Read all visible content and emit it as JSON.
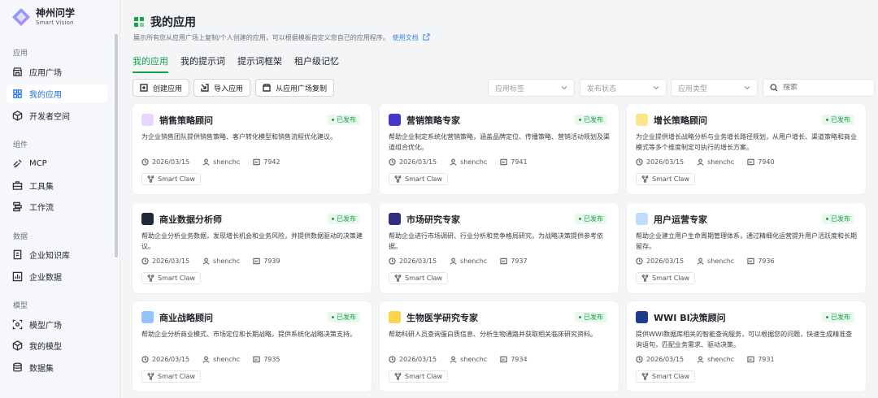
{
  "brand": {
    "name": "神州问学",
    "subtitle": "Smart Vision"
  },
  "sidebar": {
    "sections": [
      {
        "title": "应用",
        "items": [
          {
            "label": "应用广场",
            "icon": "store-icon"
          },
          {
            "label": "我的应用",
            "icon": "grid-icon",
            "active": true
          },
          {
            "label": "开发者空间",
            "icon": "cube-icon"
          }
        ]
      },
      {
        "title": "组件",
        "items": [
          {
            "label": "MCP",
            "icon": "mcp-icon"
          },
          {
            "label": "工具集",
            "icon": "toolbox-icon"
          },
          {
            "label": "工作流",
            "icon": "workflow-icon"
          }
        ]
      },
      {
        "title": "数据",
        "items": [
          {
            "label": "企业知识库",
            "icon": "book-icon"
          },
          {
            "label": "企业数据",
            "icon": "chart-icon"
          }
        ]
      },
      {
        "title": "模型",
        "items": [
          {
            "label": "模型广场",
            "icon": "target-icon"
          },
          {
            "label": "我的模型",
            "icon": "model-icon"
          },
          {
            "label": "数据集",
            "icon": "database-icon"
          }
        ]
      }
    ]
  },
  "header": {
    "title": "我的应用",
    "description": "展示所有您从应用广场上复制/个人创建的应用，可以根据模板自定义您自己的应用程序。",
    "doc_link": "使用文档"
  },
  "tabs": [
    "我的应用",
    "我的提示词",
    "提示词框架",
    "租户级记忆"
  ],
  "toolbar": {
    "create": "创建应用",
    "import": "导入应用",
    "copy": "从应用广场复制",
    "filter_tag": "应用标签",
    "filter_status": "发布状态",
    "filter_type": "应用类型",
    "search_placeholder": "搜索"
  },
  "status_label": "已发布",
  "tag_label": "Smart Claw",
  "accent": "#16a34a",
  "cards": [
    {
      "title": "销售策略顾问",
      "desc": "为企业销售团队提供销售策略、客户转化模型和销售流程优化建议。",
      "date": "2026/03/15",
      "user": "shenchc",
      "id": "7942",
      "avatar": "#e9d5ff"
    },
    {
      "title": "营销策略专家",
      "desc": "帮助企业制定系统化营销策略，涵盖品牌定位、传播策略、营销活动规划及渠道组合优化。",
      "date": "2026/03/15",
      "user": "shenchc",
      "id": "7941",
      "avatar": "#4338ca"
    },
    {
      "title": "增长策略顾问",
      "desc": "为企业提供增长战略分析与业务增长路径规划，从用户增长、渠道策略和商业模式等多个维度制定可执行的增长方案。",
      "date": "2026/03/15",
      "user": "shenchc",
      "id": "7940",
      "avatar": "#fde68a"
    },
    {
      "title": "商业数据分析师",
      "desc": "帮助企业分析业务数据，发现增长机会和业务风险，并提供数据驱动的决策建议。",
      "date": "2026/03/15",
      "user": "shenchc",
      "id": "7939",
      "avatar": "#1e293b"
    },
    {
      "title": "市场研究专家",
      "desc": "帮助企业进行市场调研、行业分析和竞争格局研究，为战略决策提供参考依据。",
      "date": "2026/03/15",
      "user": "shenchc",
      "id": "7937",
      "avatar": "#312e81"
    },
    {
      "title": "用户运营专家",
      "desc": "帮助企业建立用户生命周期管理体系，通过精细化运营提升用户活跃度和长期留存。",
      "date": "2026/03/15",
      "user": "shenchc",
      "id": "7936",
      "avatar": "#bfdbfe"
    },
    {
      "title": "商业战略顾问",
      "desc": "帮助企业分析商业模式、市场定位和长期战略，提供系统化战略决策支持。",
      "date": "2026/03/15",
      "user": "shenchc",
      "id": "7935",
      "avatar": "#93c5fd"
    },
    {
      "title": "生物医学研究专家",
      "desc": "帮助科研人员查询蛋白质信息、分析生物通路并获取相关临床研究资料。",
      "date": "2026/03/15",
      "user": "shenchc",
      "id": "7934",
      "avatar": "#fcd34d"
    },
    {
      "title": "WWI BI决策顾问",
      "desc": "提供WWI数据库相关的智能查询服务，可以根据您的问题，快速生成精准查询语句，匹配业务需求、驱动决策。",
      "date": "2026/03/15",
      "user": "shenchc",
      "id": "7931",
      "avatar": "#1e3a8a"
    }
  ]
}
